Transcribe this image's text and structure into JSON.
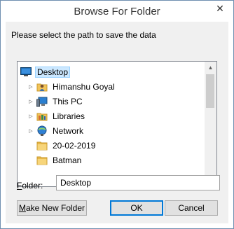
{
  "window": {
    "title": "Browse For Folder",
    "close_glyph": "✕"
  },
  "instruction": "Please select the path to save the data",
  "tree": {
    "items": [
      {
        "label": "Desktop",
        "icon": "desktop-icon",
        "expander": false,
        "selected": true
      },
      {
        "label": "Himanshu Goyal",
        "icon": "user-folder-icon",
        "expander": true
      },
      {
        "label": "This PC",
        "icon": "computer-icon",
        "expander": true
      },
      {
        "label": "Libraries",
        "icon": "libraries-icon",
        "expander": true
      },
      {
        "label": "Network",
        "icon": "network-icon",
        "expander": true
      },
      {
        "label": "20-02-2019",
        "icon": "folder-icon",
        "expander": false
      },
      {
        "label": "Batman",
        "icon": "folder-icon",
        "expander": false
      }
    ],
    "expander_glyph": "▷"
  },
  "folder": {
    "label_prefix": "F",
    "label_rest": "older:",
    "value": "Desktop"
  },
  "buttons": {
    "new_folder_prefix": "M",
    "new_folder_rest": "ake New Folder",
    "ok": "OK",
    "cancel": "Cancel"
  },
  "colors": {
    "selection": "#cce8ff",
    "accent": "#0078d7",
    "folder": "#f2c45a"
  }
}
